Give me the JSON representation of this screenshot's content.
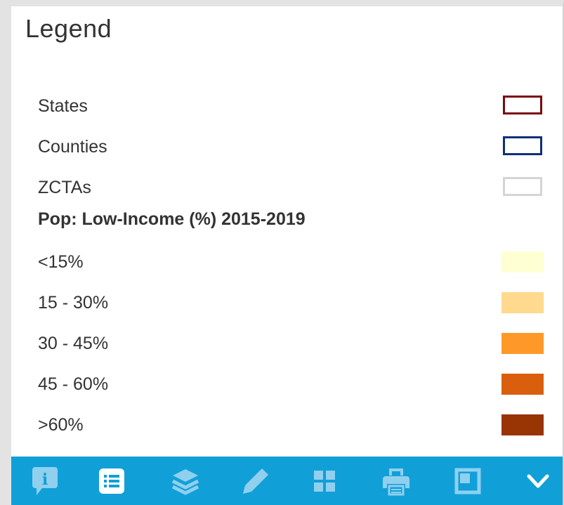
{
  "legend": {
    "title": "Legend",
    "boundaries": [
      {
        "label": "States",
        "color": "#7a0c0c",
        "style": "outline"
      },
      {
        "label": "Counties",
        "color": "#0f2f7a",
        "style": "outline"
      },
      {
        "label": "ZCTAs",
        "color": "#d4d4d4",
        "style": "outline"
      }
    ],
    "section_title": "Pop: Low-Income (%) 2015-2019",
    "classes": [
      {
        "label": "<15%",
        "color": "#ffffd4"
      },
      {
        "label": "15 - 30%",
        "color": "#fed98e"
      },
      {
        "label": "30 - 45%",
        "color": "#fe9929"
      },
      {
        "label": "45 - 60%",
        "color": "#d95f0e"
      },
      {
        "label": ">60%",
        "color": "#993404"
      }
    ]
  },
  "toolbar": {
    "background": "#119fd8",
    "tools": [
      {
        "name": "info-icon",
        "active": false
      },
      {
        "name": "legend-list-icon",
        "active": true
      },
      {
        "name": "layers-icon",
        "active": false
      },
      {
        "name": "pencil-icon",
        "active": false
      },
      {
        "name": "grid-icon",
        "active": false
      },
      {
        "name": "print-icon",
        "active": false
      },
      {
        "name": "extent-icon",
        "active": false
      },
      {
        "name": "chevron-down-icon",
        "active": false
      }
    ]
  }
}
